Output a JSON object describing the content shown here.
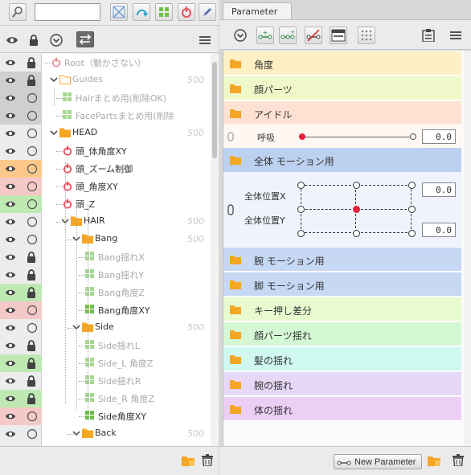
{
  "left_panel": {
    "search": {
      "value": ""
    },
    "tree": [
      {
        "label": "Root（動かさない）",
        "type": "root",
        "depth": 0,
        "dim": true,
        "num": "",
        "row_color": "",
        "locked": true,
        "lock_dark": true
      },
      {
        "label": "Guides",
        "type": "folder",
        "depth": 0,
        "dim": true,
        "num": "500",
        "row_color": "gray",
        "locked": true,
        "lock_dark": true,
        "expanded": true
      },
      {
        "label": "Hairまとめ用(削除OK)",
        "type": "part",
        "depth": 1,
        "dim": true,
        "num": "",
        "row_color": "gray",
        "locked": false
      },
      {
        "label": "FacePartsまとめ用(削除",
        "type": "part",
        "depth": 1,
        "dim": true,
        "num": "",
        "row_color": "gray",
        "locked": false
      },
      {
        "label": "HEAD",
        "type": "folder",
        "depth": 0,
        "dim": false,
        "num": "500",
        "row_color": "",
        "locked": false,
        "expanded": true
      },
      {
        "label": "頭_体角度XY",
        "type": "deformer",
        "depth": 1,
        "dim": false,
        "num": "",
        "row_color": "",
        "locked": false
      },
      {
        "label": "頭_ズーム制御",
        "type": "deformer",
        "depth": 1,
        "dim": false,
        "num": "",
        "row_color": "orange",
        "locked": false
      },
      {
        "label": "頭_角度XY",
        "type": "deformer",
        "depth": 1,
        "dim": false,
        "num": "",
        "row_color": "pink",
        "locked": false
      },
      {
        "label": "頭_Z",
        "type": "deformer",
        "depth": 1,
        "dim": false,
        "num": "",
        "row_color": "green",
        "locked": false
      },
      {
        "label": "HAIR",
        "type": "folder",
        "depth": 1,
        "dim": false,
        "num": "500",
        "row_color": "",
        "locked": false,
        "expanded": true
      },
      {
        "label": "Bang",
        "type": "folder",
        "depth": 2,
        "dim": false,
        "num": "500",
        "row_color": "",
        "locked": false,
        "expanded": true
      },
      {
        "label": "Bang揺れX",
        "type": "part",
        "depth": 3,
        "dim": true,
        "num": "",
        "row_color": "",
        "locked": true
      },
      {
        "label": "Bang揺れY",
        "type": "part",
        "depth": 3,
        "dim": true,
        "num": "",
        "row_color": "",
        "locked": true
      },
      {
        "label": "Bang角度Z",
        "type": "part",
        "depth": 3,
        "dim": true,
        "num": "",
        "row_color": "green",
        "locked": true
      },
      {
        "label": "Bang角度XY",
        "type": "part",
        "depth": 3,
        "dim": false,
        "num": "",
        "row_color": "pink",
        "locked": false
      },
      {
        "label": "Side",
        "type": "folder",
        "depth": 2,
        "dim": false,
        "num": "500",
        "row_color": "",
        "locked": false,
        "expanded": true
      },
      {
        "label": "Side揺れL",
        "type": "part",
        "depth": 3,
        "dim": true,
        "num": "",
        "row_color": "",
        "locked": true
      },
      {
        "label": "Side_L 角度Z",
        "type": "part",
        "depth": 3,
        "dim": true,
        "num": "",
        "row_color": "green",
        "locked": true
      },
      {
        "label": "Side揺れR",
        "type": "part",
        "depth": 3,
        "dim": true,
        "num": "",
        "row_color": "",
        "locked": true
      },
      {
        "label": "Side_R 角度Z",
        "type": "part",
        "depth": 3,
        "dim": true,
        "num": "",
        "row_color": "green",
        "locked": true
      },
      {
        "label": "Side角度XY",
        "type": "part",
        "depth": 3,
        "dim": false,
        "num": "",
        "row_color": "pink",
        "locked": false
      },
      {
        "label": "Back",
        "type": "folder",
        "depth": 2,
        "dim": false,
        "num": "500",
        "row_color": "",
        "locked": false,
        "expanded": true
      }
    ]
  },
  "right_panel": {
    "tab_label": "Parameter",
    "groups_top": [
      {
        "label": "角度",
        "bg": "#fdf0c4"
      },
      {
        "label": "顔パーツ",
        "bg": "#eef8c8"
      },
      {
        "label": "アイドル",
        "bg": "#fde2d4"
      }
    ],
    "idle_param": {
      "label": "呼吸",
      "value": "0.0",
      "slider": 0.0
    },
    "motion_group": {
      "label": "全体 モーション用",
      "bg": "#bcd0f0"
    },
    "xy_param": {
      "label_x": "全体位置X",
      "label_y": "全体位置Y",
      "value_x": "0.0",
      "value_y": "0.0"
    },
    "groups_bottom": [
      {
        "label": "腕 モーション用",
        "bg": "#c7d8f4"
      },
      {
        "label": "脚 モーション用",
        "bg": "#c7d8f4"
      },
      {
        "label": "キー押し差分",
        "bg": "#e8fbcf"
      },
      {
        "label": "顔パーツ揺れ",
        "bg": "#d4f8d4"
      },
      {
        "label": "髪の揺れ",
        "bg": "#cff8ef"
      },
      {
        "label": "腕の揺れ",
        "bg": "#e7d8f8"
      },
      {
        "label": "体の揺れ",
        "bg": "#ebcff5"
      }
    ],
    "new_parameter_label": "New Parameter"
  },
  "colors": {
    "folder": "#f5a623",
    "deformer": "#e8505b",
    "part": "#6cc04a",
    "row_gray": "#cfcfcf",
    "row_orange": "#fcc98a",
    "row_pink": "#f6c9c9",
    "row_green": "#bfe9b3"
  }
}
